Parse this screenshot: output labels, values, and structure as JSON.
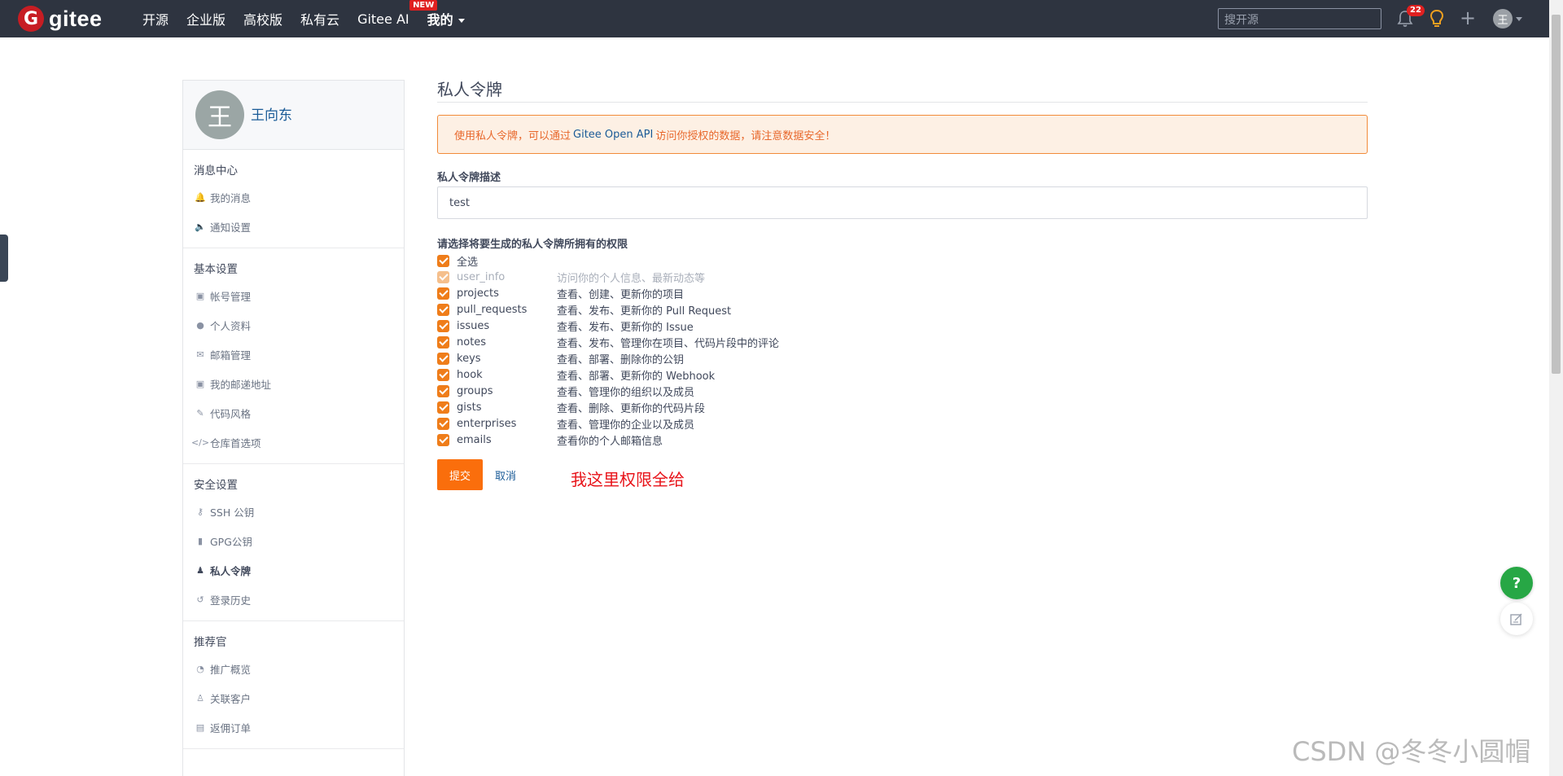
{
  "nav": {
    "logo_text": "gitee",
    "logo_mark": "G",
    "items": [
      "开源",
      "企业版",
      "高校版",
      "私有云"
    ],
    "ai_label": "Gitee AI",
    "ai_badge": "NEW",
    "mine_label": "我的",
    "search_placeholder": "搜开源",
    "notification_count": "22",
    "avatar_initial": "王"
  },
  "profile": {
    "avatar_initial": "王",
    "name": "王向东"
  },
  "sidebar": {
    "sections": [
      {
        "title": "消息中心",
        "items": [
          {
            "icon": "bell-icon",
            "glyph": "🔔",
            "label": "我的消息"
          },
          {
            "icon": "speaker-icon",
            "glyph": "🔈",
            "label": "通知设置"
          }
        ]
      },
      {
        "title": "基本设置",
        "items": [
          {
            "icon": "id-card-icon",
            "glyph": "▣",
            "label": "帐号管理"
          },
          {
            "icon": "user-icon",
            "glyph": "●",
            "label": "个人资料"
          },
          {
            "icon": "mail-icon",
            "glyph": "✉",
            "label": "邮箱管理"
          },
          {
            "icon": "address-card-icon",
            "glyph": "▣",
            "label": "我的邮递地址"
          },
          {
            "icon": "brush-icon",
            "glyph": "✎",
            "label": "代码风格"
          },
          {
            "icon": "code-icon",
            "glyph": "</>",
            "label": "仓库首选项"
          }
        ]
      },
      {
        "title": "安全设置",
        "items": [
          {
            "icon": "key-icon",
            "glyph": "⚷",
            "label": "SSH 公钥"
          },
          {
            "icon": "lock-icon",
            "glyph": "▮",
            "label": "GPG公钥"
          },
          {
            "icon": "token-icon",
            "glyph": "♟",
            "label": "私人令牌",
            "active": true
          },
          {
            "icon": "history-icon",
            "glyph": "↺",
            "label": "登录历史"
          }
        ]
      },
      {
        "title": "推荐官",
        "items": [
          {
            "icon": "dashboard-icon",
            "glyph": "◔",
            "label": "推广概览"
          },
          {
            "icon": "user-link-icon",
            "glyph": "♙",
            "label": "关联客户"
          },
          {
            "icon": "order-icon",
            "glyph": "▤",
            "label": "返佣订单"
          }
        ]
      }
    ]
  },
  "main": {
    "title": "私人令牌",
    "alert": {
      "prefix": "使用私人令牌，可以通过",
      "link": "Gitee Open API",
      "suffix": "访问你授权的数据，请注意数据安全！"
    },
    "desc_label": "私人令牌描述",
    "desc_value": "test",
    "perm_label": "请选择将要生成的私人令牌所拥有的权限",
    "select_all": "全选",
    "permissions": [
      {
        "name": "user_info",
        "desc": "访问你的个人信息、最新动态等",
        "disabled": true
      },
      {
        "name": "projects",
        "desc": "查看、创建、更新你的项目"
      },
      {
        "name": "pull_requests",
        "desc": "查看、发布、更新你的 Pull Request"
      },
      {
        "name": "issues",
        "desc": "查看、发布、更新你的 Issue"
      },
      {
        "name": "notes",
        "desc": "查看、发布、管理你在项目、代码片段中的评论"
      },
      {
        "name": "keys",
        "desc": "查看、部署、删除你的公钥"
      },
      {
        "name": "hook",
        "desc": "查看、部署、更新你的 Webhook"
      },
      {
        "name": "groups",
        "desc": "查看、管理你的组织以及成员"
      },
      {
        "name": "gists",
        "desc": "查看、删除、更新你的代码片段"
      },
      {
        "name": "enterprises",
        "desc": "查看、管理你的企业以及成员"
      },
      {
        "name": "emails",
        "desc": "查看你的个人邮箱信息"
      }
    ],
    "submit_label": "提交",
    "cancel_label": "取消",
    "annotation": "我这里权限全给"
  },
  "floating": {
    "help_label": "?"
  },
  "watermark": "CSDN @冬冬小圆帽",
  "colors": {
    "navbar": "#2e3440",
    "accent": "#fa6e0c",
    "link": "#1a5b97",
    "brand": "#c71d23"
  }
}
